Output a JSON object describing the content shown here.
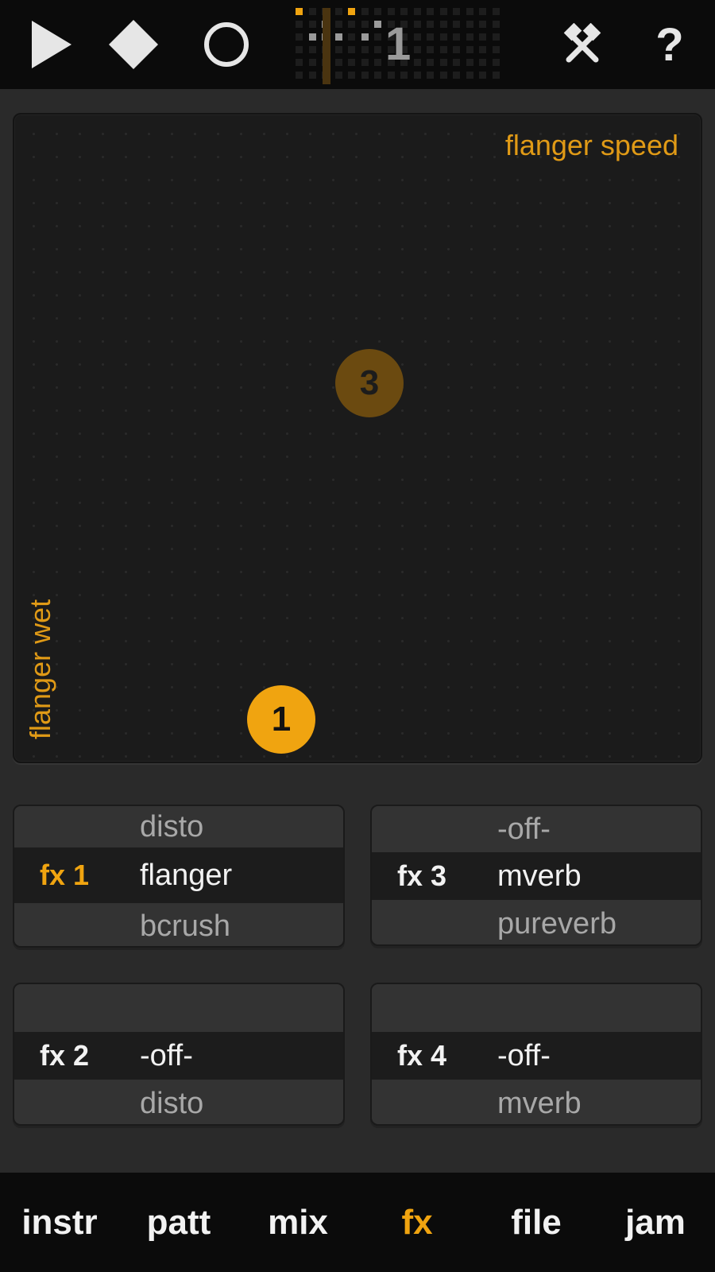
{
  "toolbar": {
    "play_icon": "play-icon",
    "stop_icon": "stop-icon",
    "record_icon": "record-icon",
    "tools_icon": "tools-icon",
    "help_label": "?",
    "pattern_number": "1"
  },
  "xy_pad": {
    "x_axis_label": "flanger speed",
    "y_axis_label": "flanger wet",
    "knobs": [
      {
        "label": "3",
        "state": "inactive"
      },
      {
        "label": "1",
        "state": "active"
      }
    ]
  },
  "fx_slots": [
    {
      "label": "fx 1",
      "prev": "disto",
      "selected": "flanger",
      "next": "bcrush",
      "active": true
    },
    {
      "label": "fx 3",
      "prev": "-off-",
      "selected": "mverb",
      "next": "pureverb",
      "active": false
    },
    {
      "label": "fx 2",
      "prev": "",
      "selected": "-off-",
      "next": "disto",
      "active": false
    },
    {
      "label": "fx 4",
      "prev": "",
      "selected": "-off-",
      "next": "mverb",
      "active": false
    }
  ],
  "tabs": [
    {
      "label": "instr",
      "active": false
    },
    {
      "label": "patt",
      "active": false
    },
    {
      "label": "mix",
      "active": false
    },
    {
      "label": "fx",
      "active": true
    },
    {
      "label": "file",
      "active": false
    },
    {
      "label": "jam",
      "active": false
    }
  ],
  "colors": {
    "accent": "#f0a410",
    "background": "#2a2a2a",
    "bar": "#0b0b0b"
  }
}
